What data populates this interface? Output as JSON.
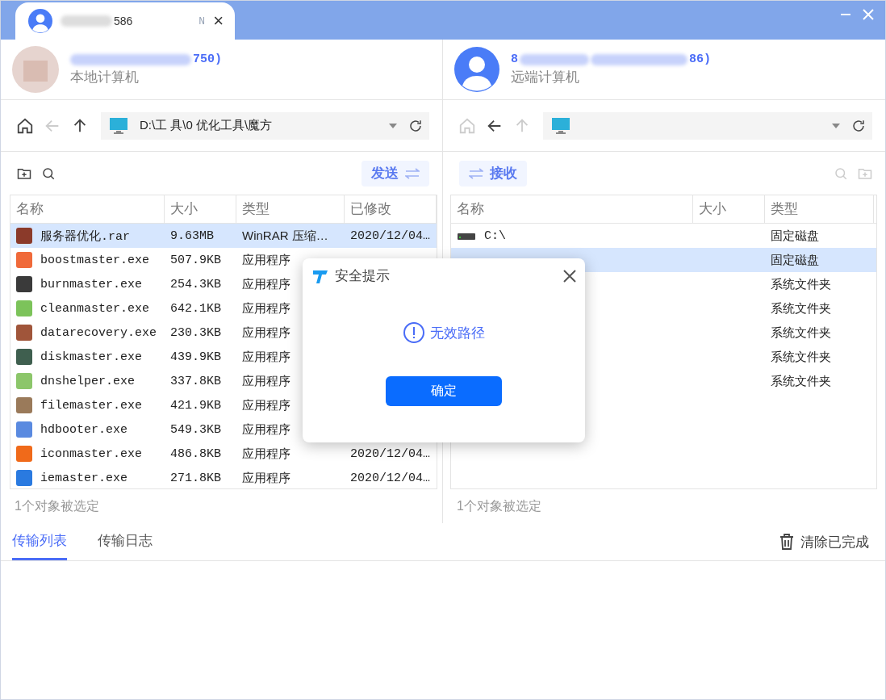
{
  "tab": {
    "title": "586",
    "badge": "N",
    "close": "×"
  },
  "local": {
    "name": "750)",
    "subtitle": "本地计算机",
    "path": "D:\\工 具\\0 优化工具\\魔方",
    "action": "发送",
    "status": "1个对象被选定",
    "nav": [
      {
        "kind": "home",
        "disabled": false
      },
      {
        "kind": "back",
        "disabled": true
      },
      {
        "kind": "up",
        "disabled": false
      }
    ],
    "columns": [
      "名称",
      "大小",
      "类型",
      "已修改"
    ],
    "rows": [
      {
        "name": "服务器优化.rar",
        "size": "9.63MB",
        "type": "WinRAR 压缩…",
        "modified": "2020/12/04…",
        "color": "#8b3a2a",
        "selected": true
      },
      {
        "name": "boostmaster.exe",
        "size": "507.9KB",
        "type": "应用程序",
        "color": "#f06a3a",
        "selected": false
      },
      {
        "name": "burnmaster.exe",
        "size": "254.3KB",
        "type": "应用程序",
        "color": "#3a3a3a",
        "selected": false
      },
      {
        "name": "cleanmaster.exe",
        "size": "642.1KB",
        "type": "应用程序",
        "color": "#7cc35a",
        "selected": false
      },
      {
        "name": "datarecovery.exe",
        "size": "230.3KB",
        "type": "应用程序",
        "color": "#a0553a",
        "selected": false
      },
      {
        "name": "diskmaster.exe",
        "size": "439.9KB",
        "type": "应用程序",
        "color": "#3f5f4f",
        "selected": false
      },
      {
        "name": "dnshelper.exe",
        "size": "337.8KB",
        "type": "应用程序",
        "color": "#8cc66a",
        "selected": false
      },
      {
        "name": "filemaster.exe",
        "size": "421.9KB",
        "type": "应用程序",
        "color": "#9a7a5a",
        "selected": false
      },
      {
        "name": "hdbooter.exe",
        "size": "549.3KB",
        "type": "应用程序",
        "color": "#5a8ae0",
        "selected": false
      },
      {
        "name": "iconmaster.exe",
        "size": "486.8KB",
        "type": "应用程序",
        "modified": "2020/12/04…",
        "color": "#f06a1a",
        "selected": false
      },
      {
        "name": "iemaster.exe",
        "size": "271.8KB",
        "type": "应用程序",
        "modified": "2020/12/04…",
        "color": "#2a7ae0",
        "selected": false
      }
    ]
  },
  "remote": {
    "name_start": "8",
    "name_end": "86)",
    "subtitle": "远端计算机",
    "action": "接收",
    "status": "1个对象被选定",
    "nav": [
      {
        "kind": "home",
        "disabled": true
      },
      {
        "kind": "back",
        "disabled": false
      },
      {
        "kind": "up",
        "disabled": true
      }
    ],
    "columns": [
      "名称",
      "大小",
      "类型"
    ],
    "rows": [
      {
        "name": "C:\\",
        "type": "固定磁盘",
        "kind": "drive",
        "selected": false
      },
      {
        "type": "固定磁盘",
        "kind": "drive",
        "selected": true
      },
      {
        "type": "系统文件夹",
        "kind": "folder",
        "selected": false
      },
      {
        "type": "系统文件夹",
        "kind": "folder",
        "selected": false
      },
      {
        "type": "系统文件夹",
        "kind": "folder",
        "selected": false
      },
      {
        "type": "系统文件夹",
        "kind": "folder",
        "selected": false
      },
      {
        "type": "系统文件夹",
        "kind": "folder",
        "selected": false
      }
    ]
  },
  "bottom_tabs": [
    {
      "label": "传输列表",
      "selected": true
    },
    {
      "label": "传输日志",
      "selected": false
    }
  ],
  "clear_button": "清除已完成",
  "dialog": {
    "title": "安全提示",
    "message": "无效路径",
    "button": "确定"
  }
}
